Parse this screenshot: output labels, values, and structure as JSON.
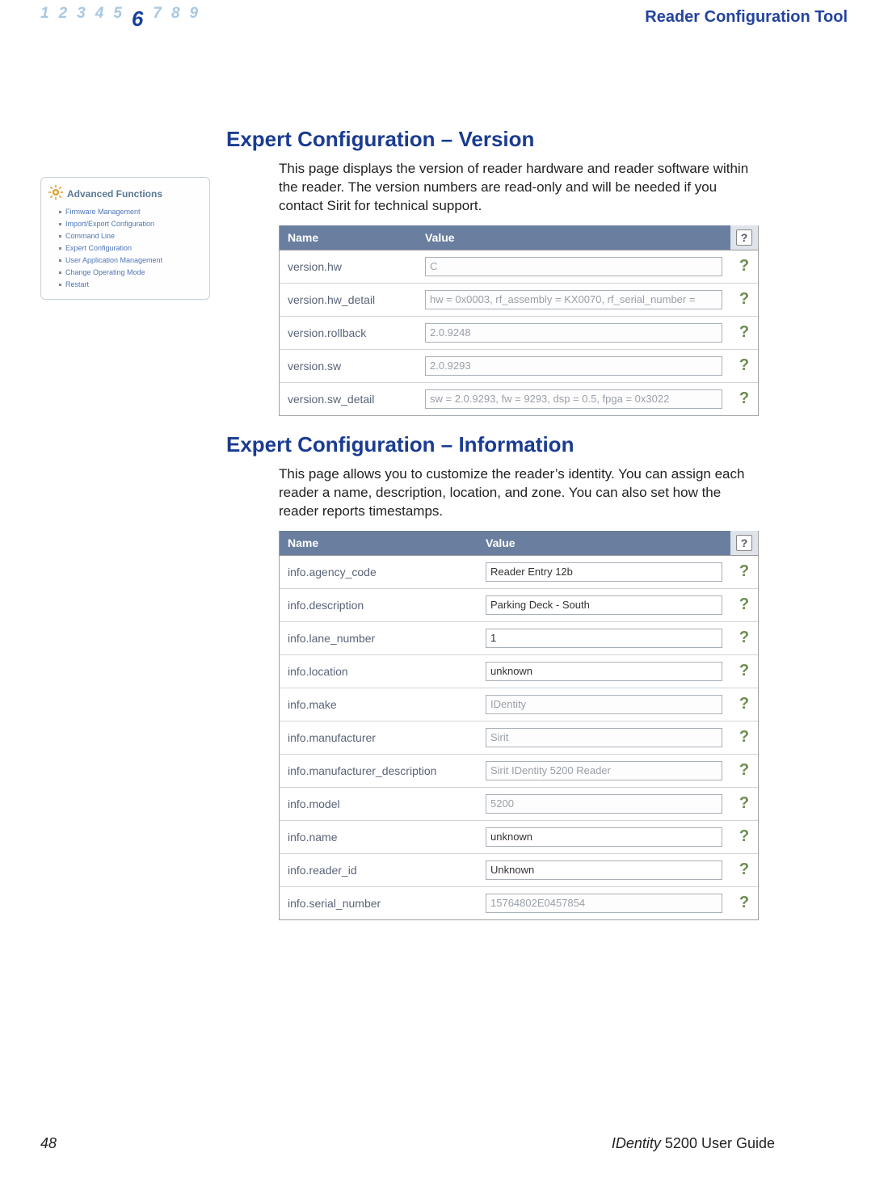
{
  "header": {
    "pages": [
      "1",
      "2",
      "3",
      "4",
      "5",
      "6",
      "7",
      "8",
      "9"
    ],
    "current_page_index": 5,
    "doc_title": "Reader Configuration Tool"
  },
  "sidebar": {
    "title": "Advanced Functions",
    "items": [
      "Firmware Management",
      "Import/Export Configuration",
      "Command Line",
      "Expert Configuration",
      "User Application Management",
      "Change Operating Mode",
      "Restart"
    ]
  },
  "section1": {
    "heading": "Expert Configuration – Version",
    "body": "This page displays the version of reader hardware and reader software within the reader. The version numbers are read-only and will be needed if you contact Sirit for technical support.",
    "table": {
      "name_header": "Name",
      "value_header": "Value",
      "rows": [
        {
          "name": "version.hw",
          "value": "C",
          "readonly": true
        },
        {
          "name": "version.hw_detail",
          "value": "hw = 0x0003, rf_assembly = KX0070, rf_serial_number =",
          "readonly": true
        },
        {
          "name": "version.rollback",
          "value": "2.0.9248",
          "readonly": true
        },
        {
          "name": "version.sw",
          "value": "2.0.9293",
          "readonly": true
        },
        {
          "name": "version.sw_detail",
          "value": "sw = 2.0.9293, fw = 9293, dsp = 0.5, fpga = 0x3022",
          "readonly": true
        }
      ]
    }
  },
  "section2": {
    "heading": "Expert Configuration – Information",
    "body": "This page allows you to customize the reader’s identity. You can assign each reader a name, description, location, and zone. You can also set how the reader reports timestamps.",
    "table": {
      "name_header": "Name",
      "value_header": "Value",
      "rows": [
        {
          "name": "info.agency_code",
          "value": "Reader Entry 12b",
          "readonly": false
        },
        {
          "name": "info.description",
          "value": "Parking Deck - South",
          "readonly": false
        },
        {
          "name": "info.lane_number",
          "value": "1",
          "readonly": false
        },
        {
          "name": "info.location",
          "value": "unknown",
          "readonly": false
        },
        {
          "name": "info.make",
          "value": "IDentity",
          "readonly": true
        },
        {
          "name": "info.manufacturer",
          "value": "Sirit",
          "readonly": true
        },
        {
          "name": "info.manufacturer_description",
          "value": "Sirit IDentity 5200 Reader",
          "readonly": true
        },
        {
          "name": "info.model",
          "value": "5200",
          "readonly": true
        },
        {
          "name": "info.name",
          "value": "unknown",
          "readonly": false
        },
        {
          "name": "info.reader_id",
          "value": "Unknown",
          "readonly": false
        },
        {
          "name": "info.serial_number",
          "value": "15764802E0457854",
          "readonly": true
        }
      ]
    }
  },
  "footer": {
    "page_number": "48",
    "brand": "IDentity",
    "guide_rest": " 5200 User Guide"
  },
  "help_glyph": "?"
}
